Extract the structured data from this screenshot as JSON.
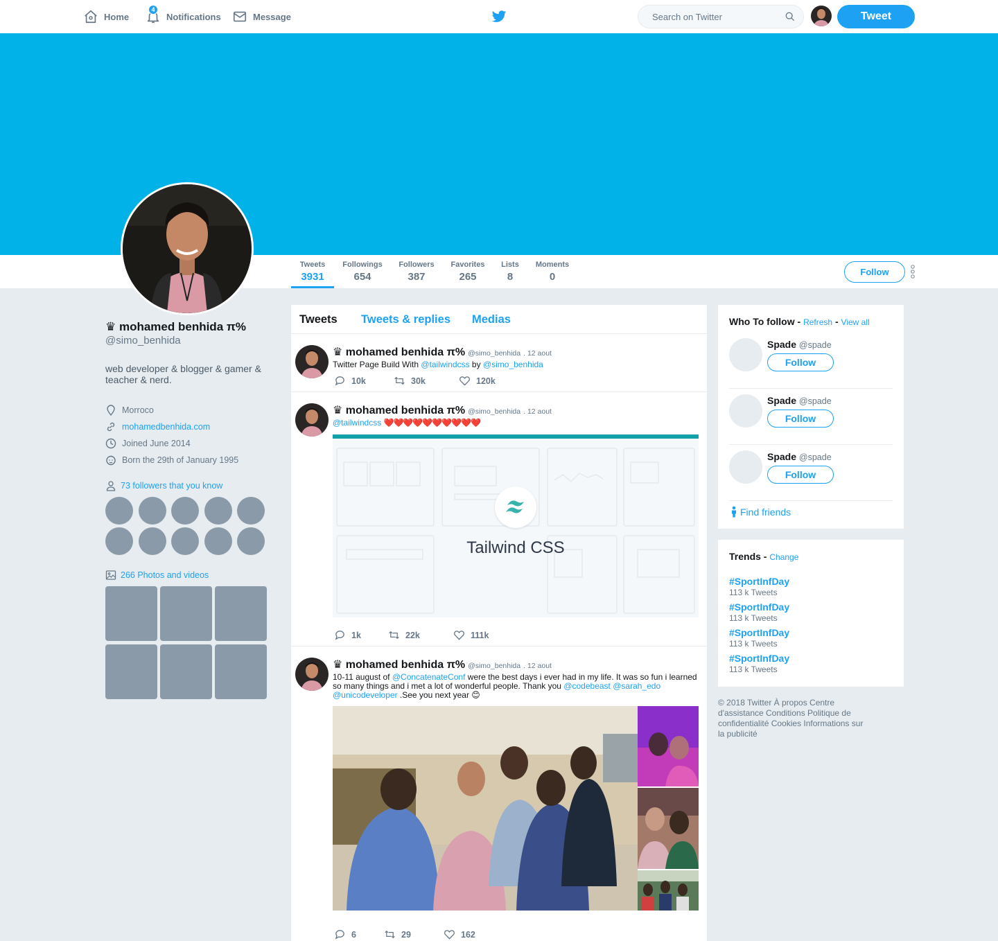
{
  "nav": {
    "home": "Home",
    "notifications": "Notifications",
    "notifications_count": "4",
    "message": "Message",
    "search_placeholder": "Search on Twitter",
    "tweet_button": "Tweet"
  },
  "stats": [
    {
      "label": "Tweets",
      "value": "3931"
    },
    {
      "label": "Followings",
      "value": "654"
    },
    {
      "label": "Followers",
      "value": "387"
    },
    {
      "label": "Favorites",
      "value": "265"
    },
    {
      "label": "Lists",
      "value": "8"
    },
    {
      "label": "Moments",
      "value": "0"
    }
  ],
  "follow_button": "Follow",
  "profile": {
    "name": "♛ mohamed benhida π%",
    "handle": "@simo_benhida",
    "bio": "web developer & blogger & gamer & teacher & nerd.",
    "location": "Morroco",
    "website": "mohamedbenhida.com",
    "joined": "Joined June 2014",
    "born": "Born the 29th of January 1995",
    "followers_you_know": "73 followers that you know",
    "photos_videos": "266 Photos and videos"
  },
  "timeline": {
    "tabs": [
      "Tweets",
      "Tweets & replies",
      "Medias"
    ],
    "tweets": [
      {
        "name": "♛ mohamed benhida π%",
        "handle": "@simo_benhida",
        "date": ". 12 aout",
        "text_pre": "Twitter Page Build With ",
        "mention1": "@tailwindcss",
        "text_mid": " by ",
        "mention2": "@simo_benhida",
        "replies": "10k",
        "retweets": "30k",
        "likes": "120k"
      },
      {
        "name": "♛ mohamed benhida π%",
        "handle": "@simo_benhida",
        "date": ". 12 aout",
        "mention1": "@tailwindcss",
        "hearts": "❤️❤️❤️❤️❤️❤️❤️❤️❤️❤️",
        "card_title": "Tailwind CSS",
        "replies": "1k",
        "retweets": "22k",
        "likes": "111k"
      },
      {
        "name": "♛ mohamed benhida π%",
        "handle": "@simo_benhida",
        "date": ". 12 aout",
        "text1": "10-11 august of ",
        "mention1": "@ConcatenateConf",
        "text2": " were the best days i ever had in my life. It was so fun i learned so many things and i met a lot of wonderful people. Thank you ",
        "mention2": "@codebeast",
        "mention3": "@sarah_edo",
        "mention4": "@unicodeveloper",
        "text3": " .See you next year 😊",
        "replies": "6",
        "retweets": "29",
        "likes": "162"
      }
    ]
  },
  "who_to_follow": {
    "title": "Who To follow",
    "sep": " - ",
    "refresh": "Refresh",
    "view_all": "View all",
    "suggestions": [
      {
        "name": "Spade",
        "handle": "@spade",
        "button": "Follow"
      },
      {
        "name": "Spade",
        "handle": "@spade",
        "button": "Follow"
      },
      {
        "name": "Spade",
        "handle": "@spade",
        "button": "Follow"
      }
    ],
    "find_friends": "Find friends"
  },
  "trends": {
    "title": "Trends",
    "sep": " - ",
    "change": "Change",
    "items": [
      {
        "tag": "#SportInfDay",
        "count": "113 k Tweets"
      },
      {
        "tag": "#SportInfDay",
        "count": "113 k Tweets"
      },
      {
        "tag": "#SportInfDay",
        "count": "113 k Tweets"
      },
      {
        "tag": "#SportInfDay",
        "count": "113 k Tweets"
      }
    ]
  },
  "footer": "© 2018 Twitter À propos Centre d'assistance Conditions Politique de confidentialité Cookies Informations sur la publicité",
  "colors": {
    "accent": "#1da1f2",
    "banner": "#00b2e8",
    "background": "#e6ecf0",
    "placeholder_gray": "#8a9aa8"
  }
}
